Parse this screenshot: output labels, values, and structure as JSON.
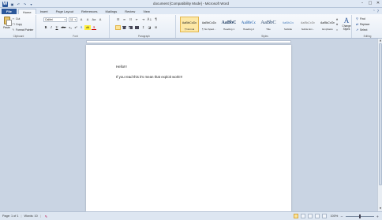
{
  "window": {
    "title": "document [Compatibility Mode] - Microsoft Word",
    "app_icon_letter": "W",
    "qat": [
      "save-icon",
      "undo-icon",
      "redo-icon",
      "customize-icon"
    ],
    "controls": [
      "–",
      "□",
      "✕"
    ]
  },
  "tabs": [
    {
      "label": "File",
      "kind": "file"
    },
    {
      "label": "Home",
      "kind": "active"
    },
    {
      "label": "Insert"
    },
    {
      "label": "Page Layout"
    },
    {
      "label": "References"
    },
    {
      "label": "Mailings"
    },
    {
      "label": "Review"
    },
    {
      "label": "View"
    }
  ],
  "ribbon": {
    "clipboard": {
      "label": "Clipboard",
      "paste": "Paste",
      "cut": "Cut",
      "copy": "Copy",
      "format_painter": "Format Painter"
    },
    "font": {
      "label": "Font",
      "family": "Calibri",
      "size": "11",
      "grow": "A",
      "shrink": "A",
      "case": "Aa",
      "clear": "A",
      "bold": "B",
      "italic": "I",
      "underline": "U",
      "strike": "abc",
      "sub": "x₂",
      "sup": "x²",
      "effects": "A",
      "highlight": "ab",
      "color": "A"
    },
    "paragraph": {
      "label": "Paragraph",
      "sort": "A↓",
      "marks": "¶"
    },
    "styles": {
      "label": "Styles",
      "items": [
        {
          "sample": "AaBbCcDc",
          "name": "¶ Normal",
          "kind": "normal",
          "selected": true
        },
        {
          "sample": "AaBbCcDc",
          "name": "¶ No Spaci...",
          "kind": "normal"
        },
        {
          "sample": "AaBbC",
          "name": "Heading 1",
          "kind": "big"
        },
        {
          "sample": "AaBbCc",
          "name": "Heading 2",
          "kind": "mid"
        },
        {
          "sample": "AaBbC",
          "name": "Title",
          "kind": "title"
        },
        {
          "sample": "AaBbCcI",
          "name": "Subtitle",
          "kind": "normal"
        },
        {
          "sample": "AaBbCcDc",
          "name": "Subtle Em...",
          "kind": "normal"
        },
        {
          "sample": "AaBbCcDc",
          "name": "Emphasis",
          "kind": "normal"
        }
      ],
      "change_styles": "Change Styles"
    },
    "editing": {
      "label": "Editing",
      "find": "Find",
      "replace": "Replace",
      "select": "Select"
    }
  },
  "document": {
    "line1": "Hello!!!",
    "line2": "If you read this it's mean that exploit work!!!"
  },
  "status": {
    "page": "Page: 1 of 1",
    "words": "Words: 10",
    "zoom": "100%",
    "zoom_level": 0.5
  }
}
